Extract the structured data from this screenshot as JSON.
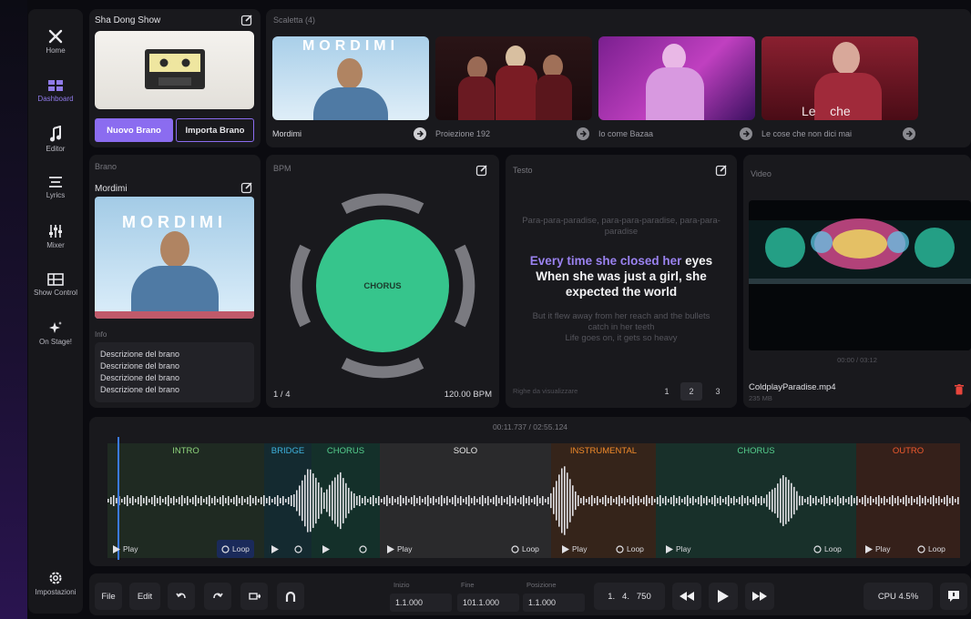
{
  "sidebar": {
    "items": [
      {
        "label": "Home",
        "icon": "tools-icon"
      },
      {
        "label": "Dashboard",
        "icon": "dashboard-icon"
      },
      {
        "label": "Editor",
        "icon": "music-note-icon"
      },
      {
        "label": "Lyrics",
        "icon": "lines-icon"
      },
      {
        "label": "Mixer",
        "icon": "mixer-icon"
      },
      {
        "label": "Show Control",
        "icon": "grid-icon"
      },
      {
        "label": "On Stage!",
        "icon": "sparkle-icon"
      }
    ],
    "settings_label": "Impostazioni"
  },
  "show": {
    "title": "Sha Dong Show",
    "new_button": "Nuovo Brano",
    "import_button": "Importa Brano"
  },
  "setlist": {
    "title": "Scaletta (4)",
    "items": [
      {
        "caption": "Mordimi",
        "thumb_text": "MORDIMI"
      },
      {
        "caption": "Proiezione 192",
        "thumb_text": ""
      },
      {
        "caption": "Io come Bazaa",
        "thumb_text": ""
      },
      {
        "caption": "Le cose che non dici mai",
        "thumb_text": "Le    che"
      }
    ]
  },
  "brano": {
    "section": "Brano",
    "title": "Mordimi",
    "cover_text": "MORDIMI",
    "info_label": "Info",
    "description": [
      "Descrizione del brano",
      "Descrizione del brano",
      "Descrizione del brano",
      "Descrizione del brano"
    ]
  },
  "bpm": {
    "title": "BPM",
    "circle_label": "CHORUS",
    "beat": "1 / 4",
    "tempo": "120.00 BPM"
  },
  "testo": {
    "title": "Testo",
    "line_before": "Para-para-paradise, para-para-paradise, para-para-paradise",
    "current_highlight": "Every time she closed her",
    "current_rest": " eyes",
    "current_line2": "When she was just a girl, she",
    "current_line3": "expected the world",
    "line_after1": "But it flew away from her reach and the bullets",
    "line_after2": "catch in her teeth",
    "line_after3": "Life goes on, it gets so heavy",
    "footer": "Righe da visualizzare",
    "pages": [
      "1",
      "2",
      "3"
    ],
    "active_page": "2"
  },
  "video": {
    "title": "Video",
    "time": "00:00 / 03:12",
    "filename": "ColdplayParadise.mp4",
    "filesize": "235 MB"
  },
  "timeline": {
    "time": "00:11.737 / 02:55.124",
    "sections": [
      {
        "label": "INTRO",
        "color": "#8ed47c"
      },
      {
        "label": "BRIDGE",
        "color": "#3fb4e0"
      },
      {
        "label": "CHORUS",
        "color": "#56d08e"
      },
      {
        "label": "SOLO",
        "color": "#e8e8e8"
      },
      {
        "label": "INSTRUMENTAL",
        "color": "#f08a2a"
      },
      {
        "label": "CHORUS",
        "color": "#56d08e"
      },
      {
        "label": "OUTRO",
        "color": "#ef5a2e"
      }
    ],
    "play_label": "Play",
    "loop_label": "Loop",
    "playhead": 0.02
  },
  "toolbar": {
    "file": "File",
    "edit": "Edit",
    "inizio_label": "Inizio",
    "inizio": "1.1.000",
    "fine_label": "Fine",
    "fine": "101.1.000",
    "posizione_label": "Posizione",
    "posizione": "1.1.000",
    "counter": "1.   4.   750",
    "cpu": "CPU 4.5%"
  },
  "colors": {
    "accent": "#8b6cf0",
    "chorus": "#36c58c",
    "bg": "#0b0b10",
    "panel": "#19191d"
  }
}
